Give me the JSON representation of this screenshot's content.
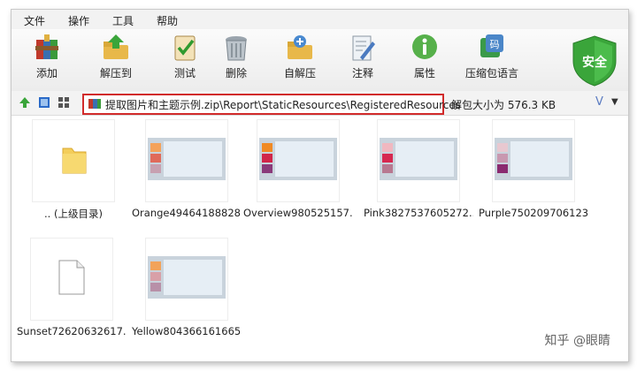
{
  "menu": [
    "文件",
    "操作",
    "工具",
    "帮助"
  ],
  "toolbar": {
    "items": [
      {
        "label": "添加",
        "icon": "add-archive-icon"
      },
      {
        "label": "解压到",
        "icon": "extract-to-icon"
      },
      {
        "label": "测试",
        "icon": "test-icon"
      },
      {
        "label": "删除",
        "icon": "delete-icon"
      },
      {
        "label": "自解压",
        "icon": "sfx-icon"
      },
      {
        "label": "注释",
        "icon": "comment-icon"
      },
      {
        "label": "属性",
        "icon": "info-icon"
      },
      {
        "label": "压缩包语言",
        "icon": "language-icon"
      }
    ],
    "security_label": "安全"
  },
  "address": {
    "path": "提取图片和主题示例.zip\\Report\\StaticResources\\RegisteredResources",
    "size_text": "解包大小为 576.3 KB"
  },
  "files": [
    {
      "name": ".. (上级目录)",
      "kind": "folder"
    },
    {
      "name": "Orange49464188828...",
      "kind": "theme",
      "swatches": [
        "#f4a25a",
        "#e06a5a",
        "#c7a0b0"
      ]
    },
    {
      "name": "Overview980525157...",
      "kind": "theme",
      "swatches": [
        "#f08a24",
        "#d1264a",
        "#8a3a7a"
      ]
    },
    {
      "name": "Pink3827537605272...",
      "kind": "theme",
      "swatches": [
        "#f0b8c0",
        "#d62850",
        "#b87890"
      ]
    },
    {
      "name": "Purple750209706123...",
      "kind": "theme",
      "swatches": [
        "#e8c8d0",
        "#c898b0",
        "#8a2a70"
      ]
    },
    {
      "name": "Sunset72620632617...",
      "kind": "blank"
    },
    {
      "name": "Yellow804366161665...",
      "kind": "theme",
      "swatches": [
        "#f2a35a",
        "#d8a0a8",
        "#b890a8"
      ]
    }
  ],
  "watermark": "知乎 @眼睛",
  "colors": {
    "highlight_border": "#d12b2b",
    "shield_green": "#3aa53a"
  }
}
